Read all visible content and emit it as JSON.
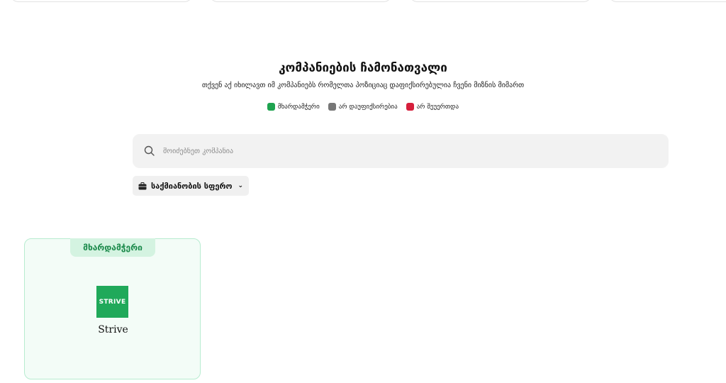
{
  "header": {
    "title": "კომპანიების ჩამონათვალი",
    "subtitle": "თქვენ აქ იხილავთ იმ კომპანიებს რომელთა პოზიციაც დაფიქსირებულია ჩვენი მიზნის მიმართ"
  },
  "legend": [
    {
      "label": "მხარდამჭერი",
      "color": "#1ea34f"
    },
    {
      "label": "არ დაუფიქსირებია",
      "color": "#777777"
    },
    {
      "label": "არ შეუერთდა",
      "color": "#d61f3c"
    }
  ],
  "search": {
    "placeholder": "მოიძებნეთ კომპანია",
    "icon": "search-icon"
  },
  "filter": {
    "label": "საქმიანობის სფერო",
    "icon": "briefcase-icon",
    "caret_icon": "chevron-down-icon"
  },
  "companies": [
    {
      "status": "მხარდამჭერი",
      "logo_text": "STRIVE",
      "name": "Strive",
      "status_color": "#1b8a4b"
    }
  ]
}
